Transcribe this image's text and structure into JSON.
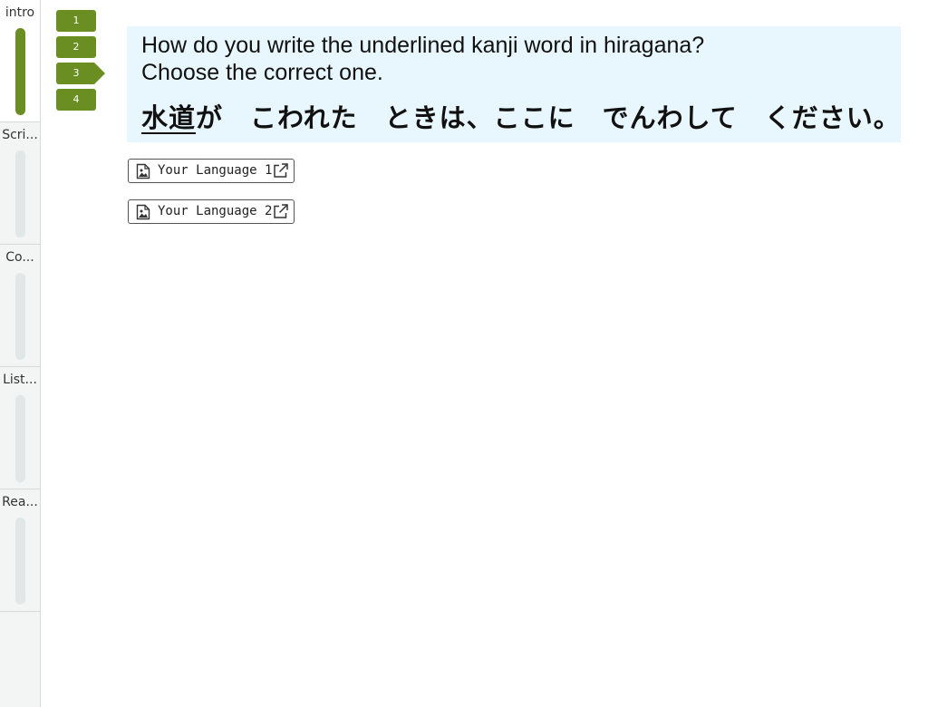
{
  "sections": [
    {
      "label": "intro",
      "active": true
    },
    {
      "label": "Scri...",
      "active": false
    },
    {
      "label": "Co...",
      "active": false
    },
    {
      "label": "List...",
      "active": false
    },
    {
      "label": "Rea...",
      "active": false
    }
  ],
  "question_numbers": [
    "1",
    "2",
    "3",
    "4"
  ],
  "current_question": "3",
  "question": {
    "prompt_line1": "How do you write the underlined kanji word in hiragana?",
    "prompt_line2": "Choose the correct one.",
    "sentence_underlined": "水道",
    "sentence_rest": "が　こわれた　ときは、ここに　でんわして　ください。"
  },
  "language_buttons": [
    {
      "label": "Your Language 1",
      "icon": "image-file-icon",
      "trailing_icon": "external-link-icon"
    },
    {
      "label": "Your Language 2",
      "icon": "image-file-icon",
      "trailing_icon": "external-link-icon"
    }
  ],
  "colors": {
    "accent": "#6b8e23",
    "question_bg": "#e8f6fd",
    "track_inactive": "#e1e6e6"
  }
}
